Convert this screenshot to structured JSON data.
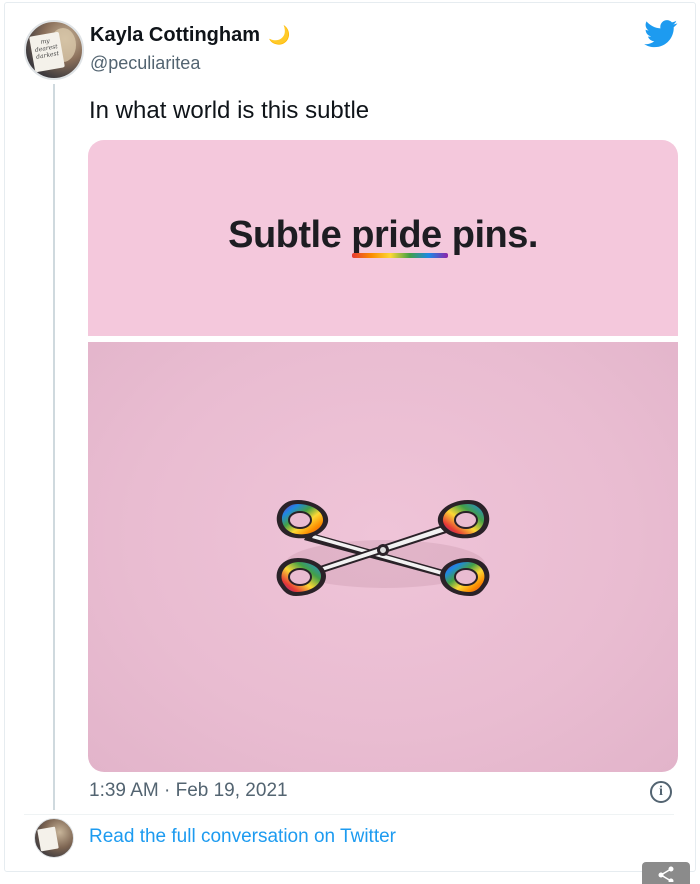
{
  "tweet": {
    "author": {
      "name": "Kayla Cottingham",
      "name_emoji": "🌙",
      "handle": "@peculiaritea",
      "avatar_sign_text": "my dearest darkest"
    },
    "text": "In what world is this subtle",
    "media": {
      "headline": "Subtle pride pins.",
      "colors": {
        "top_panel": "#f4c8dc",
        "bottom_panel": "#e9bcd1",
        "rainbow": [
          "#e53935",
          "#fb8c00",
          "#fdd835",
          "#43a047",
          "#1e88e5",
          "#8e24aa"
        ]
      }
    },
    "timestamp": "1:39 AM · Feb 19, 2021",
    "info_icon": "i",
    "read_full_label": "Read the full conversation on Twitter"
  },
  "icons": {
    "brand": "twitter-bird-icon",
    "info": "info-icon",
    "share": "share-icon"
  },
  "colors": {
    "link": "#1d9bf0",
    "secondary_text": "#536471",
    "brand": "#1d9bf0"
  }
}
